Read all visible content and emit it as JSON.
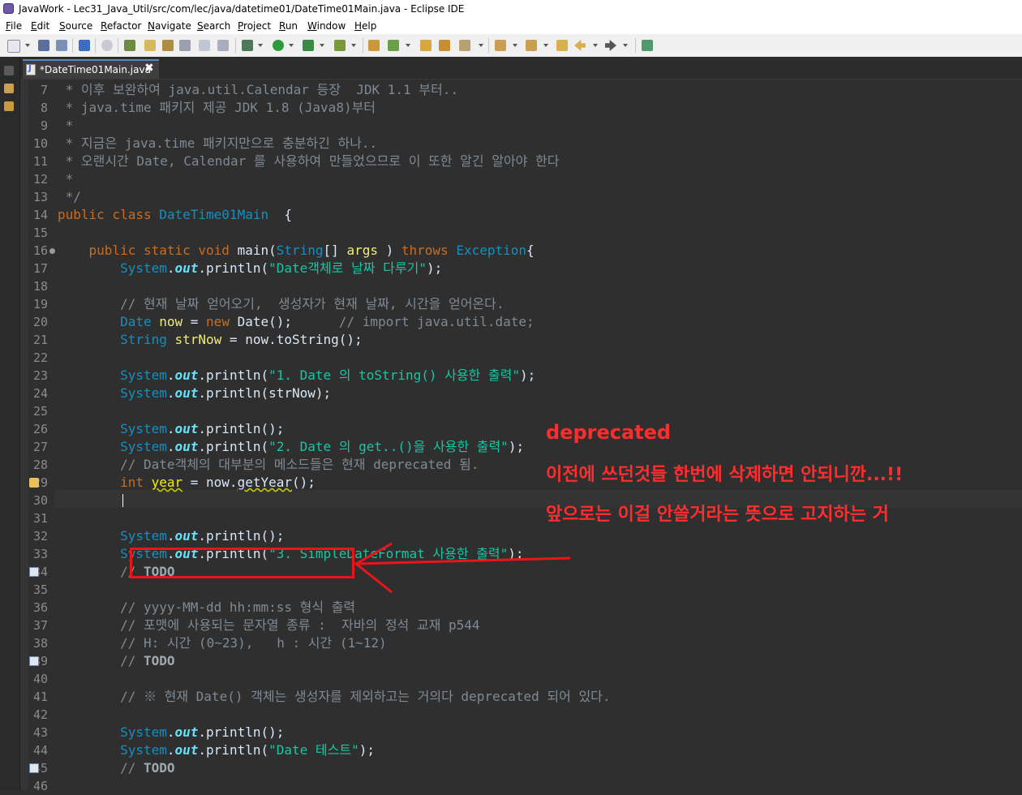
{
  "window": {
    "title": "JavaWork - Lec31_Java_Util/src/com/lec/java/datetime01/DateTime01Main.java - Eclipse IDE"
  },
  "menu": [
    "File",
    "Edit",
    "Source",
    "Refactor",
    "Navigate",
    "Search",
    "Project",
    "Run",
    "Window",
    "Help"
  ],
  "tab": {
    "label": "*DateTime01Main.java",
    "close": "✖"
  },
  "lines": [
    {
      "n": "7",
      "segs": [
        [
          "cm",
          " * 이후 보완하여 java.util.Calendar 등장  JDK 1.1 부터.."
        ]
      ]
    },
    {
      "n": "8",
      "segs": [
        [
          "cm",
          " * java.time 패키지 제공 JDK 1.8 (Java8)부터"
        ]
      ]
    },
    {
      "n": "9",
      "segs": [
        [
          "cm",
          " *"
        ]
      ]
    },
    {
      "n": "10",
      "segs": [
        [
          "cm",
          " * 지금은 java.time 패키지만으로 충분하긴 하나.."
        ]
      ]
    },
    {
      "n": "11",
      "segs": [
        [
          "cm",
          " * 오랜시간 Date, Calendar 를 사용하여 만들었으므로 이 또한 알긴 알아야 한다"
        ]
      ]
    },
    {
      "n": "12",
      "segs": [
        [
          "cm",
          " *"
        ]
      ]
    },
    {
      "n": "13",
      "segs": [
        [
          "cm",
          " */"
        ]
      ]
    },
    {
      "n": "14",
      "segs": [
        [
          "kw",
          "public class "
        ],
        [
          "ty",
          "DateTime01Main"
        ],
        [
          "",
          "  {"
        ]
      ]
    },
    {
      "n": "15",
      "segs": []
    },
    {
      "n": "16",
      "segs": [
        [
          "",
          "    "
        ],
        [
          "kw",
          "public static void "
        ],
        [
          "",
          "main("
        ],
        [
          "ty",
          "String"
        ],
        [
          "",
          "[] "
        ],
        [
          "var",
          "args"
        ],
        [
          "",
          " ) "
        ],
        [
          "kw",
          "throws "
        ],
        [
          "ty",
          "Exception"
        ],
        [
          "",
          "{"
        ]
      ]
    },
    {
      "n": "17",
      "segs": [
        [
          "",
          "        "
        ],
        [
          "ty",
          "System"
        ],
        [
          "",
          "."
        ],
        [
          "fld",
          "out"
        ],
        [
          "",
          ".println("
        ],
        [
          "str",
          "\"Date객체로 날짜 다루기\""
        ],
        [
          "",
          ");"
        ]
      ]
    },
    {
      "n": "18",
      "segs": []
    },
    {
      "n": "19",
      "segs": [
        [
          "",
          "        "
        ],
        [
          "cm",
          "// 현재 날짜 얻어오기,  생성자가 현재 날짜, 시간을 얻어온다."
        ]
      ]
    },
    {
      "n": "20",
      "segs": [
        [
          "",
          "        "
        ],
        [
          "ty",
          "Date "
        ],
        [
          "var",
          "now"
        ],
        [
          "",
          " = "
        ],
        [
          "kw",
          "new "
        ],
        [
          "",
          "Date();      "
        ],
        [
          "cm",
          "// import java.util.date;"
        ]
      ]
    },
    {
      "n": "21",
      "segs": [
        [
          "",
          "        "
        ],
        [
          "ty",
          "String "
        ],
        [
          "var",
          "strNow"
        ],
        [
          "",
          " = now.toString();"
        ]
      ]
    },
    {
      "n": "22",
      "segs": []
    },
    {
      "n": "23",
      "segs": [
        [
          "",
          "        "
        ],
        [
          "ty",
          "System"
        ],
        [
          "",
          "."
        ],
        [
          "fld",
          "out"
        ],
        [
          "",
          ".println("
        ],
        [
          "str",
          "\"1. Date 의 toString() 사용한 출력\""
        ],
        [
          "",
          ");"
        ]
      ]
    },
    {
      "n": "24",
      "segs": [
        [
          "",
          "        "
        ],
        [
          "ty",
          "System"
        ],
        [
          "",
          "."
        ],
        [
          "fld",
          "out"
        ],
        [
          "",
          ".println(strNow);"
        ]
      ]
    },
    {
      "n": "25",
      "segs": []
    },
    {
      "n": "26",
      "segs": [
        [
          "",
          "        "
        ],
        [
          "ty",
          "System"
        ],
        [
          "",
          "."
        ],
        [
          "fld",
          "out"
        ],
        [
          "",
          ".println();"
        ]
      ]
    },
    {
      "n": "27",
      "segs": [
        [
          "",
          "        "
        ],
        [
          "ty",
          "System"
        ],
        [
          "",
          "."
        ],
        [
          "fld",
          "out"
        ],
        [
          "",
          ".println("
        ],
        [
          "str",
          "\"2. Date 의 get..()을 사용한 출력\""
        ],
        [
          "",
          ");"
        ]
      ]
    },
    {
      "n": "28",
      "segs": [
        [
          "",
          "        "
        ],
        [
          "cm",
          "// Date객체의 대부분의 메소드들은 현재 deprecated 됨."
        ]
      ]
    },
    {
      "n": "29",
      "segs": [
        [
          "",
          "        "
        ],
        [
          "kw",
          "int "
        ],
        [
          "lvar sq",
          "year"
        ],
        [
          "",
          " = now."
        ],
        [
          "dep sq",
          "getYear"
        ],
        [
          "",
          "();"
        ]
      ]
    },
    {
      "n": "30",
      "segs": []
    },
    {
      "n": "31",
      "segs": []
    },
    {
      "n": "32",
      "segs": [
        [
          "",
          "        "
        ],
        [
          "ty",
          "System"
        ],
        [
          "",
          "."
        ],
        [
          "fld",
          "out"
        ],
        [
          "",
          ".println();"
        ]
      ]
    },
    {
      "n": "33",
      "segs": [
        [
          "",
          "        "
        ],
        [
          "ty",
          "System"
        ],
        [
          "",
          "."
        ],
        [
          "fld",
          "out"
        ],
        [
          "",
          ".println("
        ],
        [
          "str",
          "\"3. SimpleDateFormat 사용한 출력\""
        ],
        [
          "",
          ");"
        ]
      ]
    },
    {
      "n": "34",
      "segs": [
        [
          "",
          "        "
        ],
        [
          "cm",
          "// "
        ],
        [
          "cmt",
          "TODO"
        ]
      ]
    },
    {
      "n": "35",
      "segs": []
    },
    {
      "n": "36",
      "segs": [
        [
          "",
          "        "
        ],
        [
          "cm",
          "// yyyy-MM-dd hh:mm:ss 형식 출력"
        ]
      ]
    },
    {
      "n": "37",
      "segs": [
        [
          "",
          "        "
        ],
        [
          "cm",
          "// 포맷에 사용되는 문자열 종류 :  자바의 정석 교재 p544"
        ]
      ]
    },
    {
      "n": "38",
      "segs": [
        [
          "",
          "        "
        ],
        [
          "cm",
          "// H: 시간 (0~23),   h : 시간 (1~12)"
        ]
      ]
    },
    {
      "n": "39",
      "segs": [
        [
          "",
          "        "
        ],
        [
          "cm",
          "// "
        ],
        [
          "cmt",
          "TODO"
        ]
      ]
    },
    {
      "n": "40",
      "segs": []
    },
    {
      "n": "41",
      "segs": [
        [
          "",
          "        "
        ],
        [
          "cm",
          "// ※ 현재 Date() 객체는 생성자를 제외하고는 거의다 deprecated 되어 있다."
        ]
      ]
    },
    {
      "n": "42",
      "segs": []
    },
    {
      "n": "43",
      "segs": [
        [
          "",
          "        "
        ],
        [
          "ty",
          "System"
        ],
        [
          "",
          "."
        ],
        [
          "fld",
          "out"
        ],
        [
          "",
          ".println();"
        ]
      ]
    },
    {
      "n": "44",
      "segs": [
        [
          "",
          "        "
        ],
        [
          "ty",
          "System"
        ],
        [
          "",
          "."
        ],
        [
          "fld",
          "out"
        ],
        [
          "",
          ".println("
        ],
        [
          "str",
          "\"Date 테스트\""
        ],
        [
          "",
          ");"
        ]
      ]
    },
    {
      "n": "45",
      "segs": [
        [
          "",
          "        "
        ],
        [
          "cm",
          "// "
        ],
        [
          "cmt",
          "TODO"
        ]
      ]
    },
    {
      "n": "46",
      "segs": []
    }
  ],
  "annotation": {
    "heading": "deprecated",
    "line1": "이전에 쓰던것들 한번에 삭제하면 안되니깐...!!",
    "line2": "앞으로는 이걸 안쓸거라는 뜻으로 고지하는 거",
    "color": "#ff2d2d"
  },
  "colors": {
    "keyword": "#cc6c1d",
    "type": "#1290c3",
    "string": "#17c6a3",
    "comment": "#7f8a94",
    "field": "#66e1f8",
    "editor_bg": "#2f2f2f"
  }
}
